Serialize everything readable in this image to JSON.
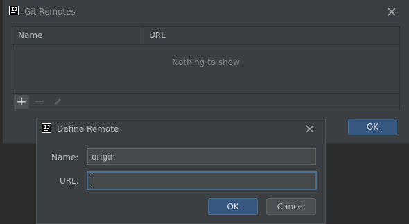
{
  "git_remotes": {
    "title": "Git Remotes",
    "columns": [
      "Name",
      "URL"
    ],
    "empty_text": "Nothing to show",
    "toolbar": {
      "add_icon": "plus-icon",
      "remove_icon": "minus-icon",
      "edit_icon": "pencil-icon"
    },
    "ok_label": "OK"
  },
  "define_remote": {
    "title": "Define Remote",
    "name_label": "Name:",
    "name_value": "origin",
    "url_label": "URL:",
    "url_value": "",
    "ok_label": "OK",
    "cancel_label": "Cancel"
  },
  "colors": {
    "dialog_bg": "#3c3f41",
    "primary_button": "#365880",
    "focus_border": "#466d94"
  }
}
